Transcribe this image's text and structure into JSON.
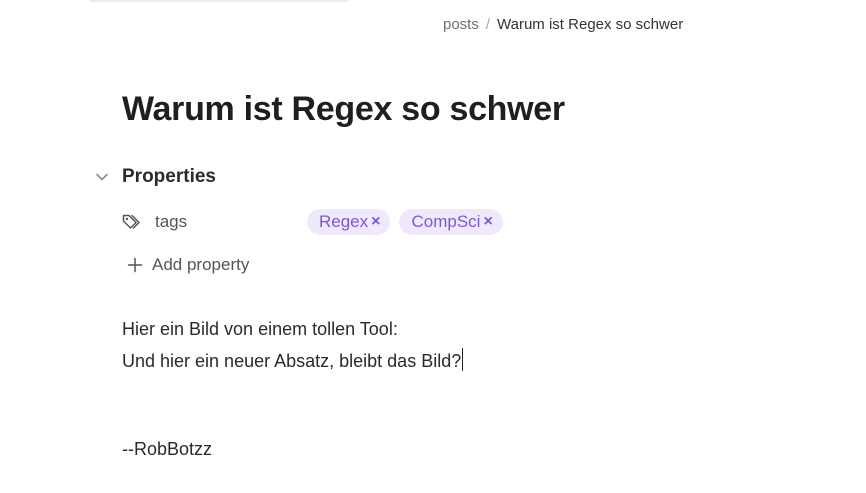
{
  "breadcrumb": {
    "parent": "posts",
    "separator": "/",
    "current": "Warum ist Regex so schwer"
  },
  "note": {
    "title": "Warum ist Regex so schwer"
  },
  "properties": {
    "header_label": "Properties",
    "chevron_icon": "chevron-down-icon",
    "rows": [
      {
        "icon": "tags-icon",
        "key": "tags",
        "values": [
          "Regex",
          "CompSci"
        ],
        "remove_symbol": "×"
      }
    ],
    "add_label": "Add property",
    "add_icon": "plus-icon"
  },
  "body": {
    "lines": [
      "Hier ein Bild von einem tollen Tool:",
      "Und hier ein neuer Absatz, bleibt das Bild?",
      "--RobBotzz"
    ]
  },
  "colors": {
    "tag_background": "#efe9fb",
    "tag_text": "#7c58d6",
    "muted_text": "#555555"
  }
}
